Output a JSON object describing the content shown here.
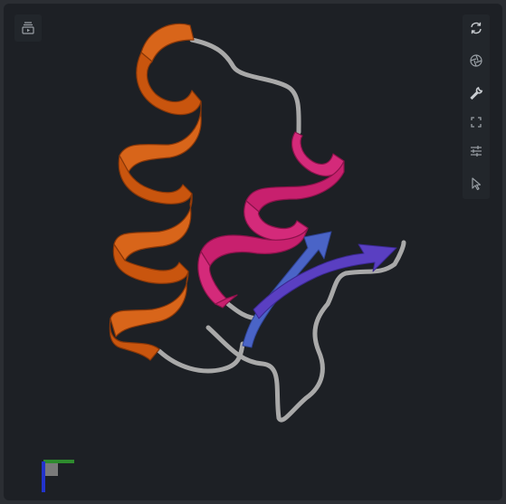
{
  "viewer": {
    "background": "#1d2025",
    "structure": "protein cartoon",
    "colors": {
      "helix_1": "#c9550e",
      "helix_2": "#c8206e",
      "strand_1": "#4a64c7",
      "strand_2": "#5a3fc2",
      "coil": "#a9a9a9"
    }
  },
  "toolbar": {
    "left": [
      {
        "icon": "sequence-panel-icon"
      }
    ],
    "right": [
      {
        "icon": "reset-view-icon"
      },
      {
        "icon": "screenshot-icon"
      },
      {
        "icon": "wrench-icon"
      },
      {
        "icon": "fullscreen-icon"
      },
      {
        "icon": "settings-sliders-icon"
      },
      {
        "icon": "selection-cursor-icon"
      }
    ]
  },
  "axes": {
    "x_color": "#2e8b2e",
    "y_color": "#2233cc",
    "z_color": "#888888"
  }
}
